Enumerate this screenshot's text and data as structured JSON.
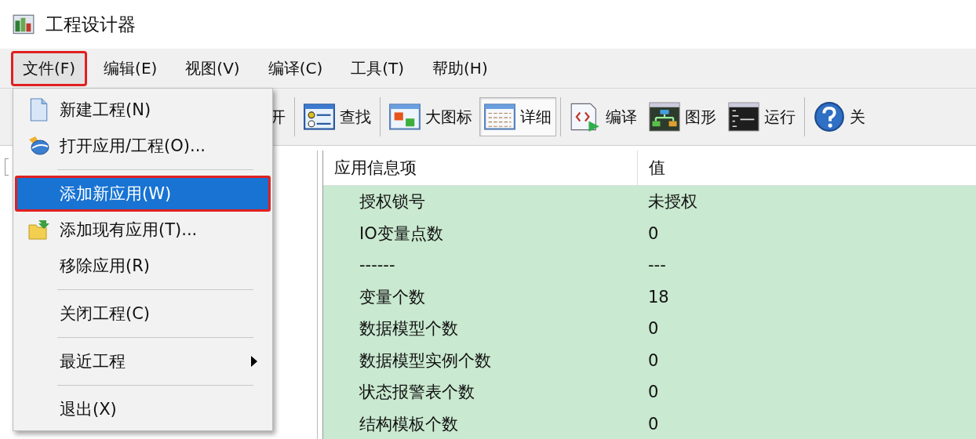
{
  "window": {
    "title": "工程设计器"
  },
  "menu_bar": [
    {
      "label": "文件(F)",
      "selected": true,
      "annotated": true
    },
    {
      "label": "编辑(E)",
      "selected": false,
      "annotated": false
    },
    {
      "label": "视图(V)",
      "selected": false,
      "annotated": false
    },
    {
      "label": "编译(C)",
      "selected": false,
      "annotated": false
    },
    {
      "label": "工具(T)",
      "selected": false,
      "annotated": false
    },
    {
      "label": "帮助(H)",
      "selected": false,
      "annotated": false
    }
  ],
  "toolbar": [
    [
      {
        "label": "开"
      }
    ],
    [
      {
        "label": "查找"
      }
    ],
    [
      {
        "label": "大图标",
        "selected": false
      },
      {
        "label": "详细",
        "selected": true
      }
    ],
    [
      {
        "label": "编译"
      },
      {
        "label": "图形"
      },
      {
        "label": "运行"
      }
    ],
    [
      {
        "label": "关"
      }
    ]
  ],
  "file_menu": [
    {
      "kind": "item",
      "label": "新建工程(N)",
      "selected": false,
      "annotated": false
    },
    {
      "kind": "item",
      "label": "打开应用/工程(O)...",
      "selected": false,
      "annotated": false
    },
    {
      "kind": "separator"
    },
    {
      "kind": "item",
      "label": "添加新应用(W)",
      "selected": true,
      "annotated": true
    },
    {
      "kind": "item",
      "label": "添加现有应用(T)...",
      "selected": false,
      "annotated": false
    },
    {
      "kind": "item",
      "label": "移除应用(R)",
      "selected": false,
      "annotated": false
    },
    {
      "kind": "separator"
    },
    {
      "kind": "item",
      "label": "关闭工程(C)",
      "selected": false,
      "annotated": false
    },
    {
      "kind": "separator"
    },
    {
      "kind": "submenu",
      "label": "最近工程",
      "selected": false,
      "annotated": false
    },
    {
      "kind": "separator"
    },
    {
      "kind": "item",
      "label": "退出(X)",
      "selected": false,
      "annotated": false
    }
  ],
  "table": {
    "columns": [
      "应用信息项",
      "值"
    ],
    "rows": [
      [
        "授权锁号",
        "未授权"
      ],
      [
        "IO变量点数",
        "0"
      ],
      [
        "------",
        "---"
      ],
      [
        "变量个数",
        "18"
      ],
      [
        "数据模型个数",
        "0"
      ],
      [
        "数据模型实例个数",
        "0"
      ],
      [
        "状态报警表个数",
        "0"
      ],
      [
        "结构模板个数",
        "0"
      ]
    ]
  }
}
